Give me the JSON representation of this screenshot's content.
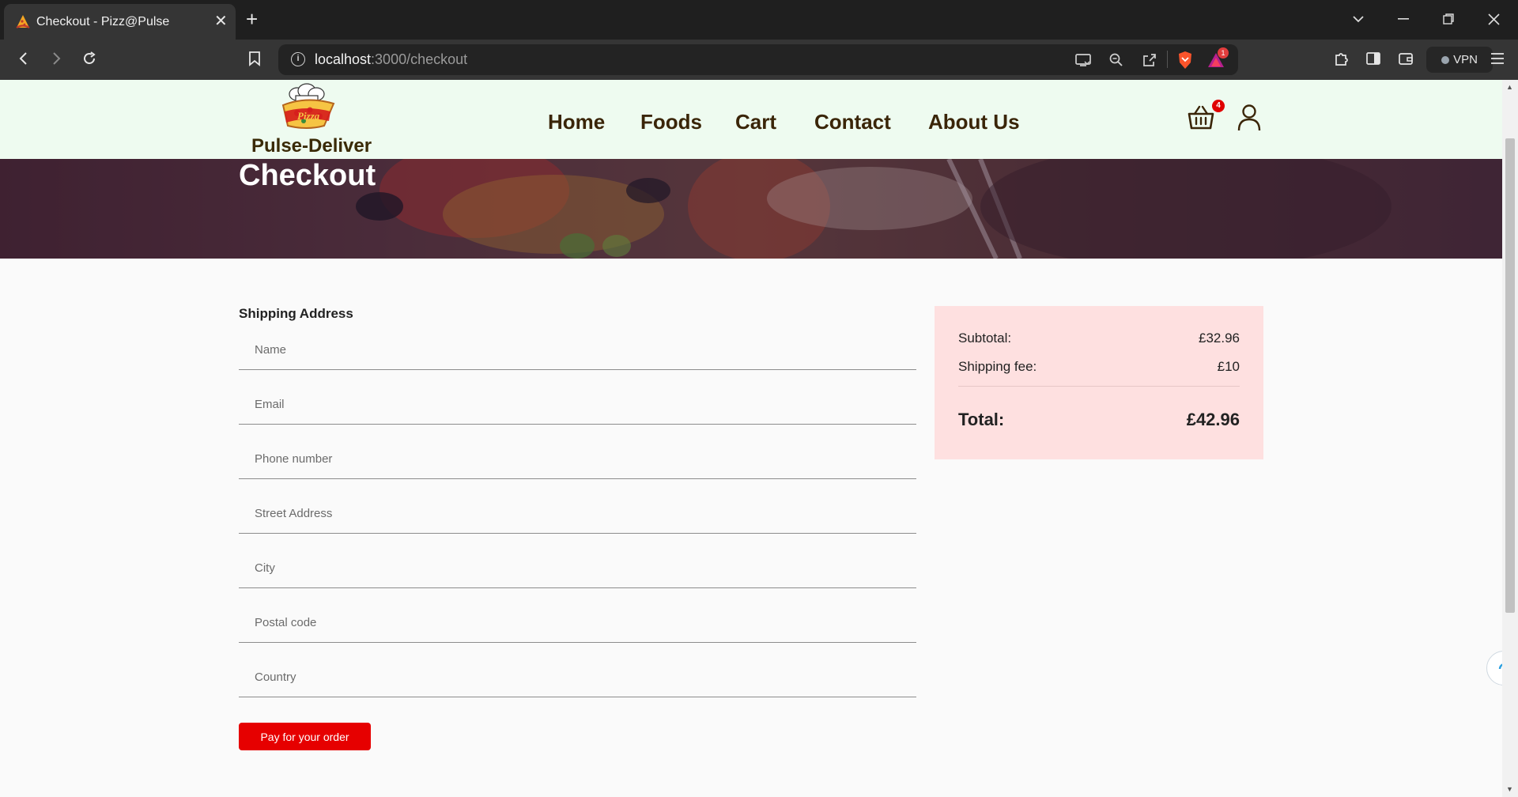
{
  "browser": {
    "tab_title": "Checkout - Pizz@Pulse",
    "url_host": "localhost",
    "url_path": ":3000/checkout",
    "brave_badge": "1",
    "vpn_label": "VPN"
  },
  "site": {
    "brand": "Pulse-Deliver",
    "nav": [
      "Home",
      "Foods",
      "Cart",
      "Contact",
      "About Us"
    ],
    "cart_count": "4"
  },
  "hero": {
    "title": "Checkout"
  },
  "form": {
    "title": "Shipping Address",
    "fields": {
      "name": "Name",
      "email": "Email",
      "phone": "Phone number",
      "street": "Street Address",
      "city": "City",
      "postal": "Postal code",
      "country": "Country"
    },
    "submit": "Pay for your order"
  },
  "summary": {
    "subtotal_label": "Subtotal:",
    "subtotal_value": "£32.96",
    "shipping_label": "Shipping fee:",
    "shipping_value": "£10",
    "total_label": "Total:",
    "total_value": "£42.96"
  },
  "colors": {
    "header_bg": "#eefbf0",
    "brand_text": "#3a2508",
    "pay_button": "#e60000",
    "summary_bg": "#fee0e0",
    "badge": "#e00000"
  }
}
